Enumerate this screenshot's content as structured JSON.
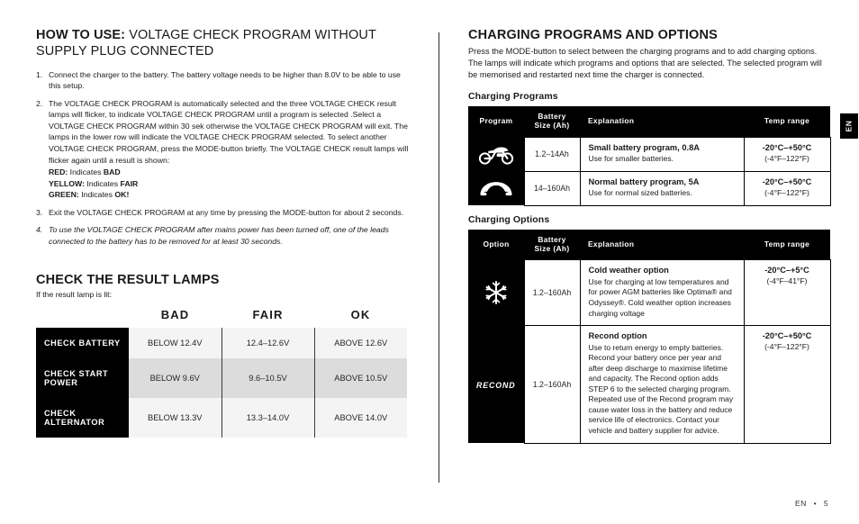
{
  "left": {
    "heading_bold": "HOW TO USE:",
    "heading_rest": " VOLTAGE CHECK PROGRAM WITHOUT SUPPLY PLUG CONNECTED",
    "steps": [
      {
        "num": "1.",
        "text": "Connect the charger to the battery. The battery voltage needs to be higher than 8.0V to be able to use this setup."
      },
      {
        "num": "2.",
        "text": "The VOLTAGE CHECK PROGRAM is automatically selected and the three VOLTAGE CHECK result lamps will flicker, to indicate VOLTAGE CHECK PROGRAM until a program is selected .Select a VOLTAGE CHECK PROGRAM within 30 sek otherwise the VOLTAGE CHECK PROGRAM will exit. The lamps in the lower row will indicate the VOLTAGE CHECK PROGRAM selected. To select another VOLTAGE CHECK PROGRAM, press the MODE-button briefly. The VOLTAGE CHECK result lamps will flicker again until a result is shown:",
        "lamps": [
          {
            "color": "RED:",
            "middle": " Indicates ",
            "result": "BAD"
          },
          {
            "color": "YELLOW:",
            "middle": " Indicates ",
            "result": "FAIR"
          },
          {
            "color": "GREEN:",
            "middle": " Indicates ",
            "result": "OK!"
          }
        ]
      },
      {
        "num": "3.",
        "text": "Exit the VOLTAGE CHECK PROGRAM at any time by pressing the MODE-button for about 2 seconds."
      },
      {
        "num": "4.",
        "italic": true,
        "text": "To use the VOLTAGE CHECK PROGRAM after mains power has been turned off, one of the leads connected to the battery has to be removed for at least 30 seconds."
      }
    ],
    "result_section": {
      "title": "CHECK THE RESULT LAMPS",
      "subtitle": "If the result lamp is lit:",
      "columns": [
        "BAD",
        "FAIR",
        "OK"
      ],
      "rows": [
        {
          "label": "CHECK BATTERY",
          "bad": "BELOW 12.4V",
          "fair": "12.4–12.6V",
          "ok": "ABOVE 12.6V"
        },
        {
          "label": "CHECK START POWER",
          "bad": "BELOW 9.6V",
          "fair": "9.6–10.5V",
          "ok": "ABOVE 10.5V"
        },
        {
          "label": "CHECK ALTERNATOR",
          "bad": "BELOW 13.3V",
          "fair": "13.3–14.0V",
          "ok": "ABOVE 14.0V"
        }
      ]
    }
  },
  "right": {
    "title": "CHARGING PROGRAMS AND OPTIONS",
    "lead": "Press the MODE-button to select between the charging programs and to add charging options. The lamps will indicate which programs and options that are selected. The selected program will be memorised and restarted next time the charger is connected.",
    "programs": {
      "caption": "Charging Programs",
      "headers": {
        "col1": "Program",
        "col2_line1": "Battery",
        "col2_line2": "Size (Ah)",
        "col3": "Explanation",
        "col4": "Temp range"
      },
      "rows": [
        {
          "icon": "motorcycle-icon",
          "size": "1.2–14Ah",
          "title": "Small battery program, 0.8A",
          "body": "Use for smaller batteries.",
          "temp_main": "-20°C–+50°C",
          "temp_sub": "(-4°F–122°F)"
        },
        {
          "icon": "car-icon",
          "size": "14–160Ah",
          "title": "Normal battery program, 5A",
          "body": "Use for normal sized batteries.",
          "temp_main": "-20°C–+50°C",
          "temp_sub": "(-4°F–122°F)"
        }
      ]
    },
    "options": {
      "caption": "Charging Options",
      "headers": {
        "col1": "Option",
        "col2_line1": "Battery",
        "col2_line2": "Size (Ah)",
        "col3": "Explanation",
        "col4": "Temp range"
      },
      "rows": [
        {
          "icon": "snowflake-icon",
          "icon_text": "",
          "size": "1.2–160Ah",
          "title": "Cold weather option",
          "body": "Use for charging at low temperatures and for power AGM batteries like Optima® and Odyssey®. Cold weather option increases charging voltage",
          "temp_main": "-20°C–+5°C",
          "temp_sub": "(-4°F–41°F)"
        },
        {
          "icon": "recond-label",
          "icon_text": "RECOND",
          "size": "1.2–160Ah",
          "title": "Recond option",
          "body": "Use to return energy to empty batteries. Recond your battery once per year and after deep discharge to maximise lifetime and capacity. The Recond option adds STEP 6 to the selected charging program. Repeated use of the Recond program may cause water loss in the battery and reduce service life of electronics. Contact your vehicle and battery supplier for advice.",
          "temp_main": "-20°C–+50°C",
          "temp_sub": "(-4°F–122°F)"
        }
      ]
    }
  },
  "side_tab": {
    "label": "EN"
  },
  "footer": {
    "lang": "EN",
    "separator": "•",
    "page": "5"
  },
  "colors": {
    "ink": "#000000",
    "paper": "#ffffff",
    "row_light": "#f4f4f4",
    "row_dark": "#dcdcdc"
  }
}
